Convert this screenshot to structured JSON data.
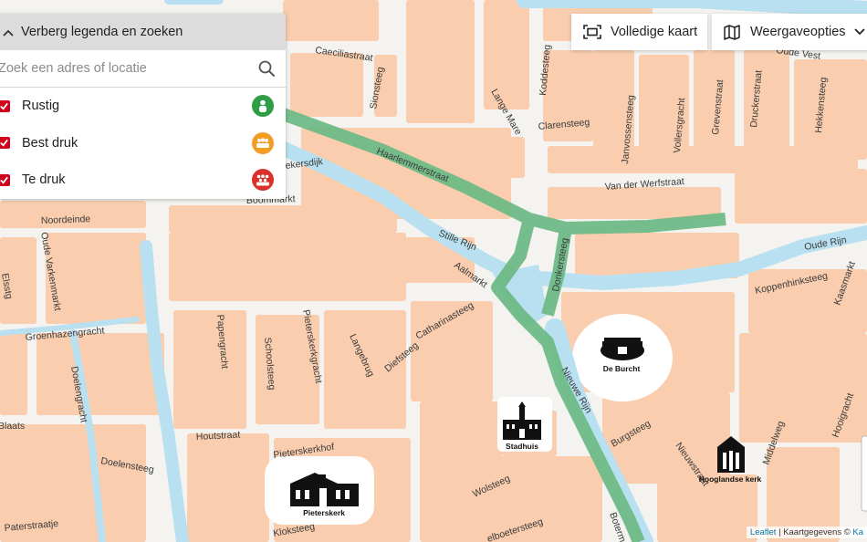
{
  "map": {
    "streets": [
      "Caeciliastraat",
      "Sionsteeg",
      "Koddesteeg",
      "Lange Mare",
      "Clarensteeg",
      "Janvossensteeg",
      "Vollersgracht",
      "Grevenstraat",
      "Druckerstraat",
      "Hekkensteeg",
      "Oude Vest",
      "Haarlemmerstraat",
      "Van der Werfstraat",
      "ekersdijk",
      "Boommarkt",
      "Noordeinde",
      "Stille Rijn",
      "Oude Rijn",
      "Oude Varkenmarkt",
      "Aalmarkt",
      "Donkersteeg",
      "Koppenhinksteeg",
      "Kaasmarkt",
      "Groenhazengracht",
      "Catharinasteeg",
      "Pieterskerkgracht",
      "Papengracht",
      "Schoolsteeg",
      "Langebrug",
      "Diefsteeg",
      "Doelengracht",
      "Nieuwe Rijn",
      "Houtstraat",
      "Doelensteeg",
      "Pieterskerkhof",
      "Burgsteeg",
      "Nieuwstraat",
      "Middelweg",
      "Hooigracht",
      "Wolsteeg",
      "Kloksteeg",
      "Paterstraatje",
      "Botermarkt",
      "elboetersteeg",
      "Blaats",
      "Elsstg"
    ],
    "landmarks": [
      "De Burcht",
      "Stadhuis",
      "Pieterskerk",
      "Hooglandse kerk"
    ],
    "colors": {
      "land": "#f9cdae",
      "road": "#ffffff",
      "water": "#b9e0f0",
      "route": "#6fbb87",
      "background": "#f4f3ef"
    }
  },
  "panel": {
    "toggle_label": "Verberg legenda en zoeken",
    "chevron_icon": "chevron-up-icon",
    "search": {
      "placeholder": "Zoek een adres of locatie",
      "value": "",
      "icon": "search-icon"
    },
    "legend": [
      {
        "label": "Rustig",
        "checked": true,
        "color": "#2e9e46",
        "icon": "person-icon"
      },
      {
        "label": "Best druk",
        "checked": true,
        "color": "#f39c23",
        "icon": "group-icon"
      },
      {
        "label": "Te druk",
        "checked": true,
        "color": "#d8322b",
        "icon": "crowd-icon"
      }
    ]
  },
  "toolbar": {
    "fullscreen_label": "Volledige kaart",
    "fullscreen_icon": "fullscreen-icon",
    "view_label": "Weergaveopties",
    "view_icon": "map-icon",
    "view_chevron": "chevron-down-icon"
  },
  "attribution": {
    "leaflet": "Leaflet",
    "separator": " | ",
    "text": "Kaartgegevens © ",
    "link": "Ka"
  }
}
